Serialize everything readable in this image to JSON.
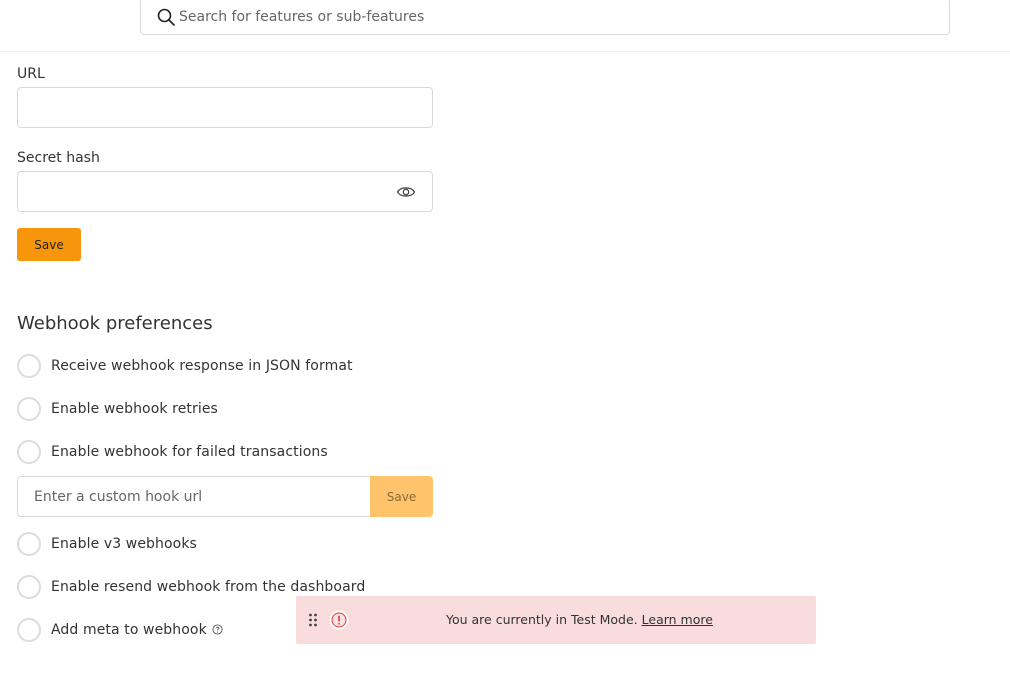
{
  "search": {
    "placeholder": "Search for features or sub-features"
  },
  "form": {
    "url_label": "URL",
    "url_value": "",
    "secret_label": "Secret hash",
    "secret_value": "",
    "save_label": "Save"
  },
  "preferences": {
    "title": "Webhook preferences",
    "items": [
      {
        "label": "Receive webhook response in JSON format",
        "checked": false
      },
      {
        "label": "Enable webhook retries",
        "checked": false
      },
      {
        "label": "Enable webhook for failed transactions",
        "checked": false
      },
      {
        "label": "Enable v3 webhooks",
        "checked": false
      },
      {
        "label": "Enable resend webhook from the dashboard",
        "checked": false
      },
      {
        "label": "Add meta to webhook",
        "checked": false
      }
    ],
    "custom_hook": {
      "placeholder": "Enter a custom hook url",
      "save_label": "Save"
    }
  },
  "toast": {
    "message": "You are currently in Test Mode.",
    "link": "Learn more"
  },
  "colors": {
    "accent": "#f7960b",
    "accent_disabled": "#ffc46b",
    "toast_bg": "#f9dddd",
    "alert": "#e0393e"
  }
}
